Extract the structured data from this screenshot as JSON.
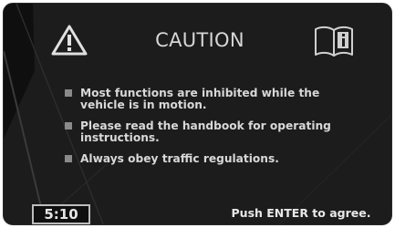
{
  "screen": {
    "title": "CAUTION",
    "warning_icon": "warning-triangle-icon",
    "info_icon": "handbook-info-icon",
    "messages": [
      {
        "text": "Most functions are inhibited while the vehicle is in motion."
      },
      {
        "text": "Please read the handbook for operating instructions."
      },
      {
        "text": "Always obey traffic regulations."
      }
    ],
    "clock": "5:10",
    "prompt": "Push ENTER to agree."
  },
  "colors": {
    "background": "#1c1c1c",
    "text": "#d8d8d8",
    "bullet": "#8a8a8a"
  }
}
